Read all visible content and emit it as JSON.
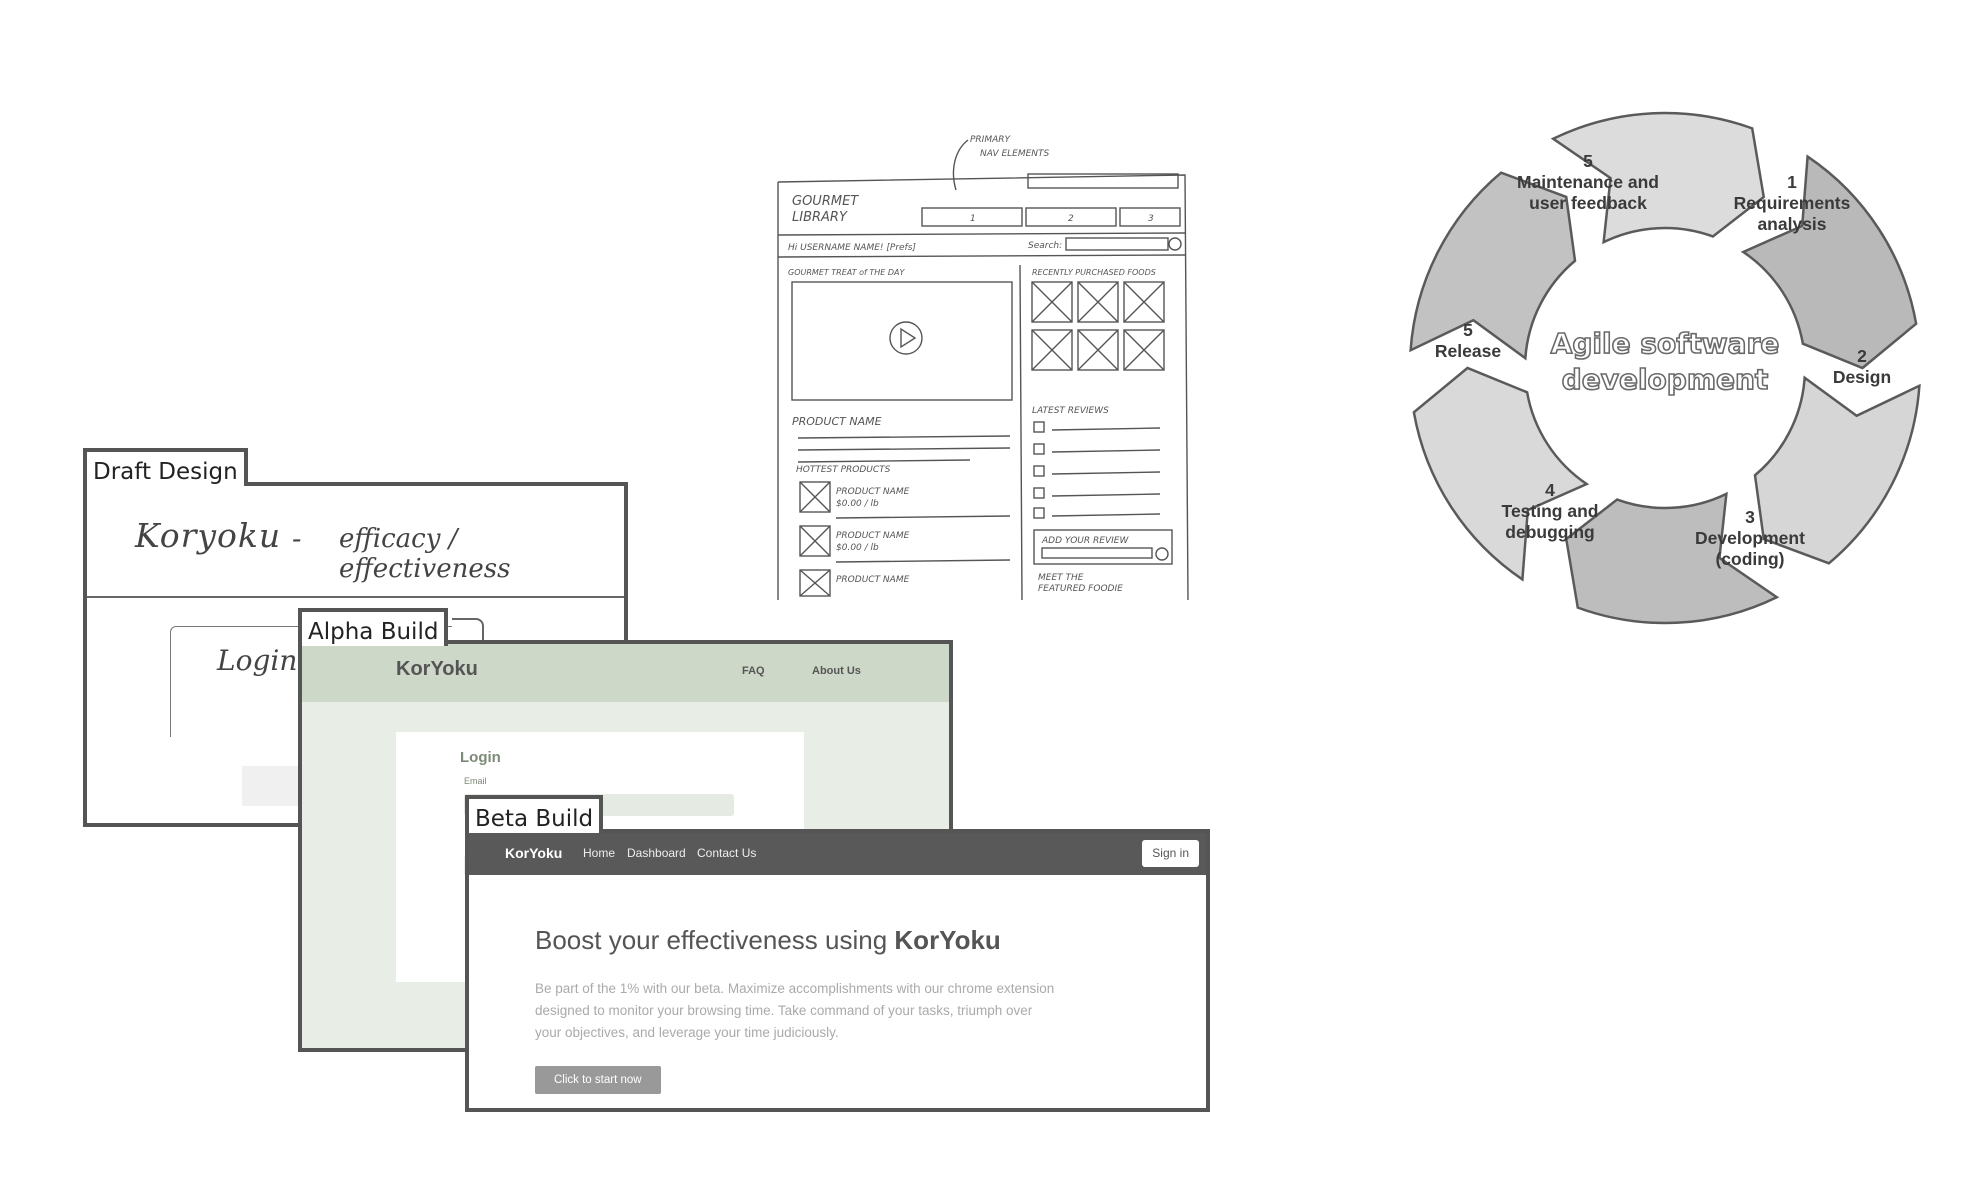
{
  "draft": {
    "tab": "Draft Design",
    "title": "Koryoku",
    "dash": "-",
    "subtitle": "efficacy / effectiveness",
    "login": "Login"
  },
  "alpha": {
    "tab": "Alpha Build",
    "logo": "KorYoku",
    "nav": [
      "FAQ",
      "About Us"
    ],
    "login_title": "Login",
    "email_label": "Email"
  },
  "beta": {
    "tab": "Beta Build",
    "brand": "KorYoku",
    "nav": [
      "Home",
      "Dashboard",
      "Contact Us"
    ],
    "signin": "Sign in",
    "headline_prefix": "Boost your effectiveness using ",
    "headline_brand": "KorYoku",
    "body": "Be part of the 1% with our beta. Maximize accomplishments with our chrome extension designed to monitor your browsing time. Take command of your tasks, triumph over your objectives, and leverage your time judiciously.",
    "cta": "Click to start now"
  },
  "sketch": {
    "annotation": [
      "PRIMARY",
      "NAV ELEMENTS"
    ],
    "logo": [
      "GOURMET",
      "LIBRARY"
    ],
    "tabs": [
      "1",
      "2",
      "3"
    ],
    "greeting": "Hi USERNAME NAME! [Prefs]",
    "search": "Search:",
    "treat": "GOURMET TREAT of THE DAY",
    "recent": "RECENTLY PURCHASED FOODS",
    "product": "PRODUCT NAME",
    "latest": "LATEST REVIEWS",
    "hottest": "HOTTEST PRODUCTS",
    "item1": [
      "PRODUCT NAME",
      "$0.00 / lb"
    ],
    "item2": [
      "PRODUCT NAME",
      "$0.00 / lb"
    ],
    "item3": "PRODUCT NAME",
    "add_review": "ADD YOUR REVIEW",
    "meet": [
      "MEET THE",
      "FEATURED FOODIE"
    ]
  },
  "cycle": {
    "center": [
      "Agile software",
      "development"
    ],
    "stages": [
      {
        "num": "1",
        "lines": [
          "Requirements",
          "analysis"
        ]
      },
      {
        "num": "2",
        "lines": [
          "Design"
        ]
      },
      {
        "num": "3",
        "lines": [
          "Development",
          "(coding)"
        ]
      },
      {
        "num": "4",
        "lines": [
          "Testing and",
          "debugging"
        ]
      },
      {
        "num": "5",
        "lines": [
          "Release"
        ]
      },
      {
        "num": "5",
        "lines": [
          "Maintenance and",
          "user feedback"
        ]
      }
    ]
  }
}
